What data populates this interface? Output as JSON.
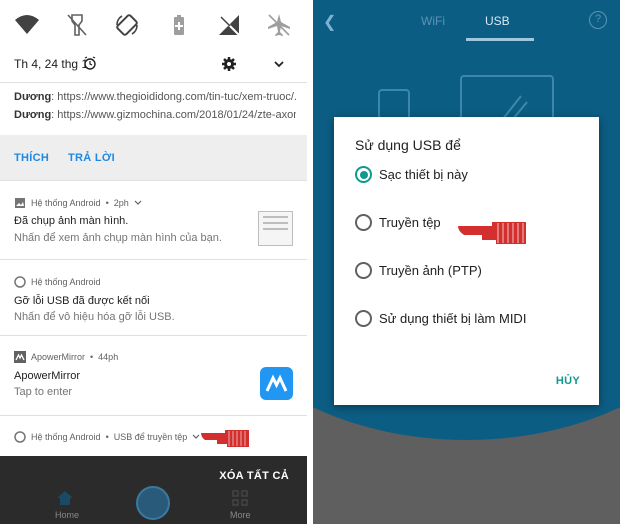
{
  "left": {
    "quick_settings": {
      "date": "Th 4, 24 thg 1",
      "icons": [
        "wifi-icon",
        "flashlight-icon",
        "auto-rotate-icon",
        "battery-saver-icon",
        "mobile-data-icon",
        "airplane-mode-icon"
      ]
    },
    "message": {
      "line1_sender": "Dương",
      "line1_text": ": https://www.thegioididong.com/tin-tuc/xem-truoc/...",
      "line2_sender": "Dương",
      "line2_text": ": https://www.gizmochina.com/2018/01/24/zte-axon...",
      "action_reply_all": "THÍCH",
      "action_reply": "TRẢ LỜI"
    },
    "notifications": [
      {
        "app": "Hệ thống Android",
        "time": "2ph",
        "title": "Đã chụp ảnh màn hình.",
        "text": "Nhấn để xem ảnh chụp màn hình của bạn."
      },
      {
        "app": "Hệ thống Android",
        "time": "",
        "title": "Gỡ lỗi USB đã được kết nối",
        "text": "Nhấn để vô hiệu hóa gỡ lỗi USB."
      },
      {
        "app": "ApowerMirror",
        "time": "44ph",
        "title": "ApowerMirror",
        "text": "Tap to enter"
      },
      {
        "app": "Hệ thống Android",
        "time": "USB để truyền tệp",
        "title": "",
        "text": ""
      }
    ],
    "bottom": {
      "clear_all": "XÓA TẤT CẢ",
      "home": "Home",
      "more": "More"
    }
  },
  "right": {
    "tabs": [
      "WiFi",
      "USB"
    ],
    "active_tab": "USB",
    "help": "?",
    "dialog": {
      "title": "Sử dụng USB để",
      "options": [
        "Sạc thiết bị này",
        "Truyền tệp",
        "Truyền ảnh (PTP)",
        "Sử dụng thiết bị làm MIDI"
      ],
      "selected_index": 0,
      "cancel": "HỦY"
    }
  },
  "colors": {
    "accent_blue": "#1e88e5",
    "teal": "#11998e",
    "app_header_blue": "#0c5d84",
    "pointer_red": "#d32f2f"
  }
}
